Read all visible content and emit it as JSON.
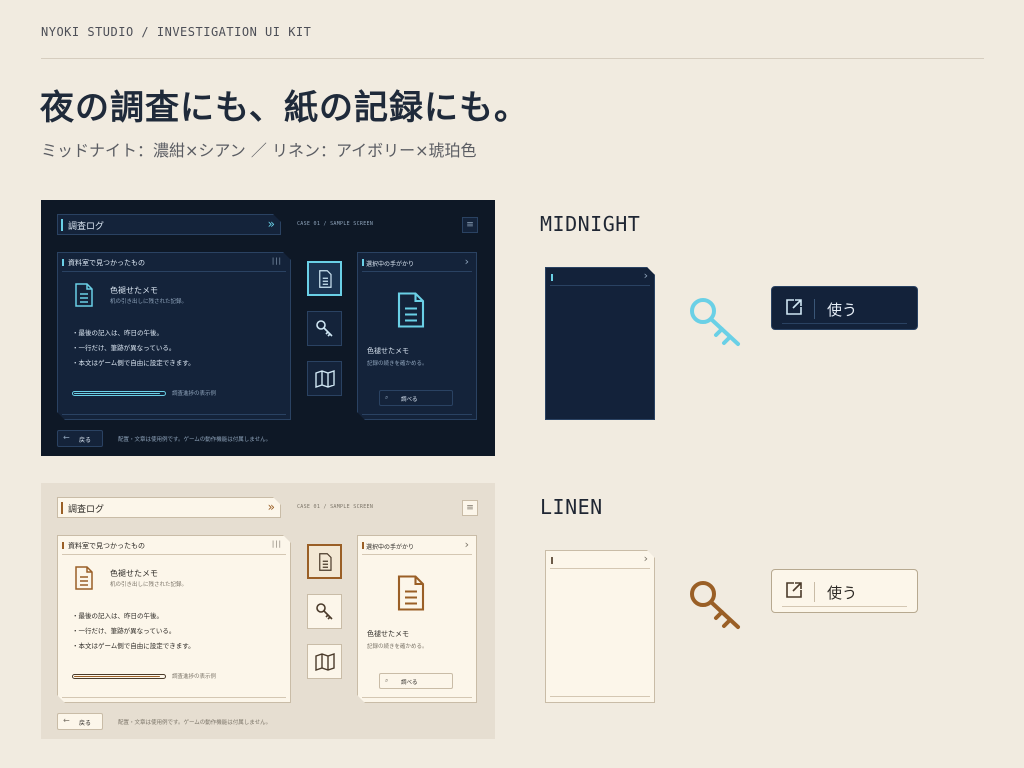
{
  "header": {
    "kicker": "NYOKI STUDIO / INVESTIGATION UI KIT",
    "headline": "夜の調査にも、紙の記録にも。",
    "subhead": "ミッドナイト：濃紺×シアン ／ リネン：アイボリー×琥珀色"
  },
  "screen": {
    "title": "調査ログ",
    "case_label": "CASE 01 / SAMPLE SCREEN",
    "found_header": "資料室で見つかったもの",
    "item_title": "色褪せたメモ",
    "item_sub": "机の引き出しに残された記録。",
    "bullets": [
      "・最後の記入は、昨日の午後。",
      "・一行だけ、筆跡が異なっている。",
      "・本文はゲーム側で自由に設定できます。"
    ],
    "progress_label": "調査進捗の表示例",
    "progress_value": 0.96,
    "clue_header": "選択中の手がかり",
    "clue_title": "色褪せたメモ",
    "clue_sub": "記録の続きを確かめる。",
    "search_label": "調べる",
    "back_label": "戻る",
    "footnote": "配置・文章は使用例です。ゲームの動作機能は付属しません。",
    "tools": [
      "document-icon",
      "key-icon",
      "map-icon"
    ]
  },
  "themes": {
    "midnight": {
      "label": "MIDNIGHT",
      "use_label": "使う",
      "accent": "#6ad0e6",
      "base": "#0e1826"
    },
    "linen": {
      "label": "LINEN",
      "use_label": "使う",
      "accent": "#9a5f26",
      "base": "#fcf6ea"
    }
  }
}
